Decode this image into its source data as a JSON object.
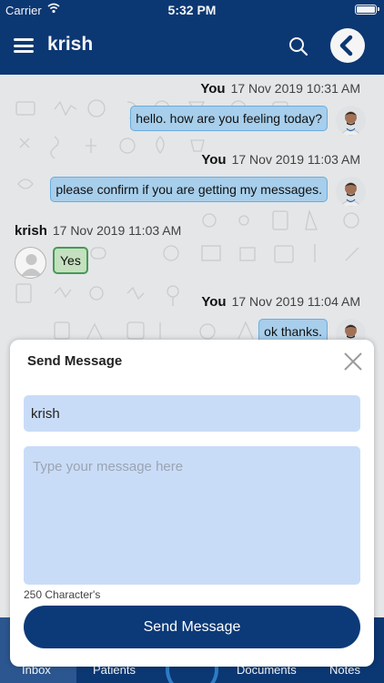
{
  "status_bar": {
    "carrier": "Carrier",
    "time": "5:32 PM"
  },
  "header": {
    "title": "krish"
  },
  "messages": [
    {
      "sender": "You",
      "timestamp": "17 Nov 2019 10:31 AM",
      "text": "hello. how are you feeling today?",
      "direction": "outgoing"
    },
    {
      "sender": "You",
      "timestamp": "17 Nov 2019 11:03 AM",
      "text": "please confirm if you are getting my messages.",
      "direction": "outgoing"
    },
    {
      "sender": "krish",
      "timestamp": "17 Nov 2019 11:03 AM",
      "text": "Yes",
      "direction": "incoming"
    },
    {
      "sender": "You",
      "timestamp": "17 Nov 2019 11:04 AM",
      "text": "ok thanks.",
      "direction": "outgoing"
    }
  ],
  "tab_bar": {
    "tabs": [
      {
        "label": "Inbox"
      },
      {
        "label": "Patients"
      },
      {
        "label": "Documents"
      },
      {
        "label": "Notes"
      }
    ]
  },
  "modal": {
    "title": "Send Message",
    "to_value": "krish",
    "message_placeholder": "Type your message here",
    "char_count": "250 Character's",
    "send_label": "Send Message"
  },
  "colors": {
    "primary": "#0c3a78",
    "outgoing_bubble": "#aed7f5",
    "incoming_bubble": "#cdeac6",
    "input_bg": "#c9dcf7"
  }
}
